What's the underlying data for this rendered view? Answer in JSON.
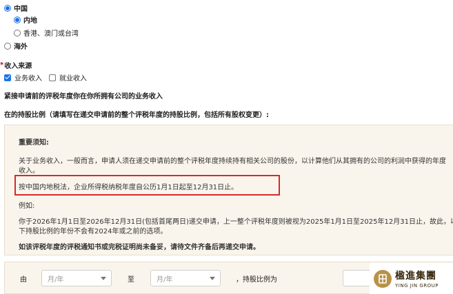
{
  "region": {
    "china": "中国",
    "mainland": "内地",
    "hk_macau_tw": "香港、澳门或台湾",
    "overseas": "海外"
  },
  "income": {
    "label": "收入来源",
    "business": "业务收入",
    "employment": "就业收入"
  },
  "section": {
    "heading1": "紧接申请前的评税年度你在你所拥有公司的业务收入",
    "heading2": "在的持股比例（请填写在递交申请前的整个评税年度的持股比例，包括所有股权变更）:"
  },
  "notice": {
    "title": "重要须知:",
    "p1_line1": "关于业务收入，一般而言，申请人须在递交申请前的整个评税年度持续持有相关公司的股份，以计算他们从其拥有的公司的利润中获得的年度",
    "p1_line2": "收入。",
    "highlight": "按中国内地税法，企业所得税纳税年度自公历1月1日起至12月31日止。",
    "example_label": "例如:",
    "example_line1": "你于2026年1月1日至2026年12月31日(包括首尾两日)递交申请，上一整个评税年度则被视为2025年1月1日至2025年12月31日止，故此，以",
    "example_line2": "下持股比例的年份不会有2024年或之前的选项。",
    "closing": "如该评税年度的评税通知书或完税证明尚未备妥，请待文件齐备后再递交申请。"
  },
  "period": {
    "from_label": "由",
    "to_label": "至",
    "ratio_label": "，持股比例为",
    "from_placeholder": "月/年",
    "to_placeholder": "月/年"
  },
  "logo": {
    "name": "楹進集團",
    "sub": "YING JIN GROUP"
  },
  "colors": {
    "accent": "#1a73e8",
    "highlight_border": "#d62828",
    "notice_bg": "#faf5ec",
    "logo_gold": "#b8924a"
  }
}
